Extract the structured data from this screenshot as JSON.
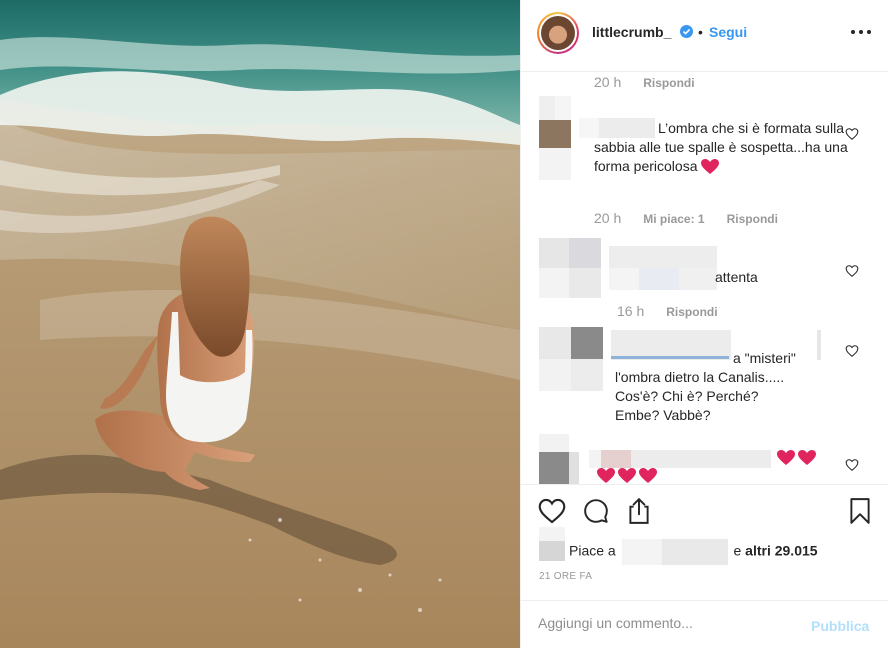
{
  "post": {
    "username": "littlecrumb_",
    "separator": "•",
    "follow_label": "Segui"
  },
  "comments": [
    {
      "time": "20 h",
      "reply_label": "Rispondi"
    },
    {
      "text": "L’ombra che si è formata sulla sabbia alle tue spalle è sospetta...ha una forma pericolosa",
      "time": "20 h",
      "likes_label": "Mi piace: 1",
      "reply_label": "Rispondi"
    },
    {
      "text": "attenta",
      "time": "16 h",
      "reply_label": "Rispondi"
    },
    {
      "text_lines": [
        "a \"misteri\"",
        "l'ombra dietro la Canalis.....",
        "Cos'è? Chi è? Perché?",
        "Embe? Vabbè?"
      ]
    }
  ],
  "actions": {
    "likes_prefix": "Piace a",
    "likes_suffix_and": "e",
    "likes_others": "altri 29.015",
    "timestamp": "21 ORE FA"
  },
  "add_comment": {
    "placeholder": "Aggiungi un commento...",
    "publish_label": "Pubblica"
  },
  "colors": {
    "link_blue": "#3897f0",
    "publish_disabled": "#b2dffc",
    "heart_red": "#e0245e"
  }
}
